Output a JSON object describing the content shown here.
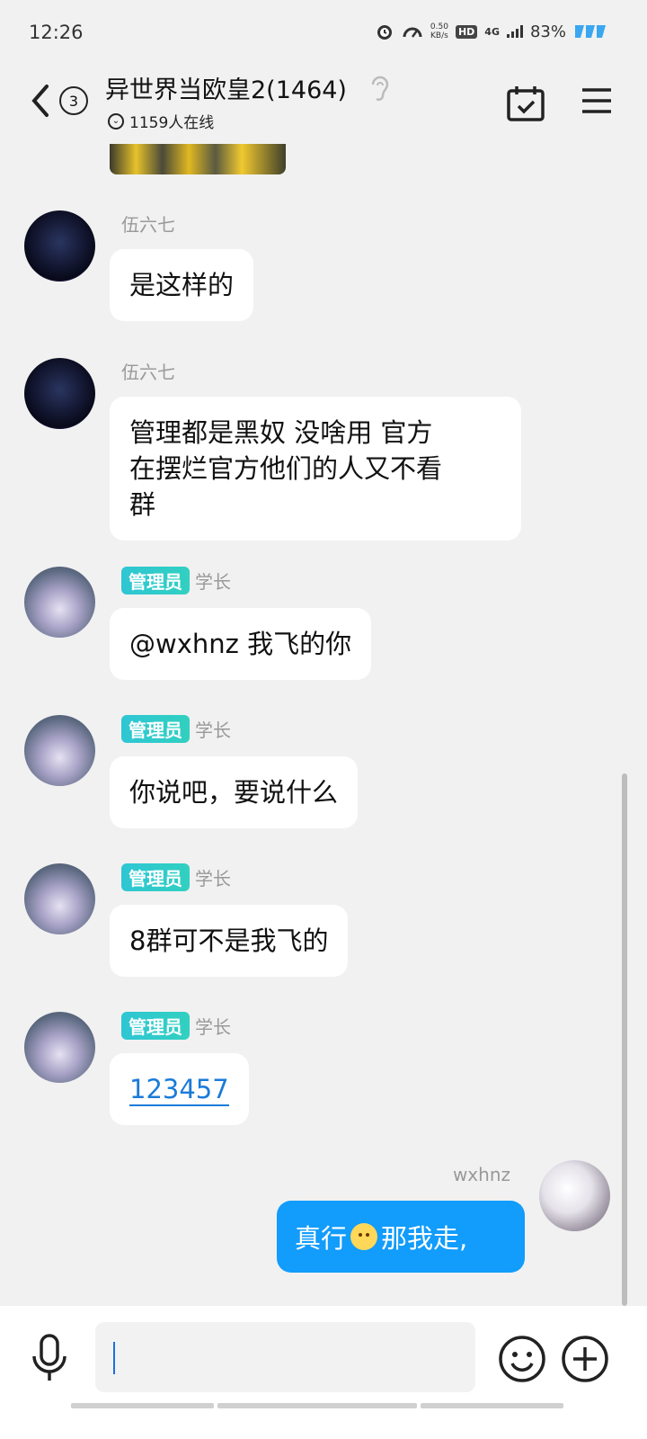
{
  "status_bar": {
    "time": "12:26",
    "speed_value": "0.50",
    "speed_unit": "KB/s",
    "hd": "HD",
    "network": "4G",
    "battery": "83%"
  },
  "header": {
    "back_count": "3",
    "title": "异世界当欧皇2(1464)",
    "online_count": "1159人在线"
  },
  "messages": [
    {
      "sender": "伍六七",
      "text": "是这样的"
    },
    {
      "sender": "伍六七",
      "line1": "管理都是黑奴  没啥用 官方",
      "line2": "在摆烂官方他们的人又不看",
      "line3": "群"
    },
    {
      "badge": "管理员",
      "sender": "学长",
      "text": "@wxhnz 我飞的你"
    },
    {
      "badge": "管理员",
      "sender": "学长",
      "text": "你说吧，要说什么"
    },
    {
      "badge": "管理员",
      "sender": "学长",
      "text": "8群可不是我飞的"
    },
    {
      "badge": "管理员",
      "sender": "学长",
      "text": "123457"
    }
  ],
  "my_message": {
    "sender": "wxhnz",
    "text_before": "真行",
    "text_after": "那我走,"
  },
  "colors": {
    "my_bubble": "#129cfb",
    "admin_badge": "#2ec6d4",
    "link": "#1b7bd8"
  }
}
